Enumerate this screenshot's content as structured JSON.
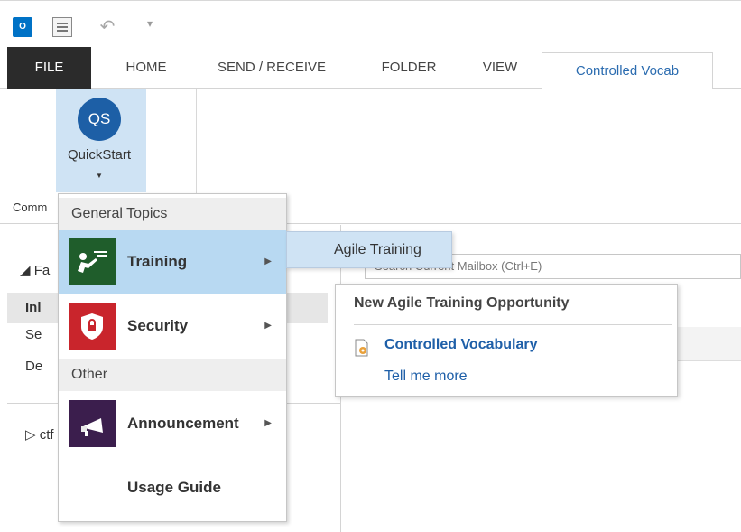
{
  "qat": {
    "app_icon_text": "O",
    "undo_glyph": "↶",
    "dropdown_glyph": "▾"
  },
  "tabs": {
    "file": "FILE",
    "home": "HOME",
    "send_receive": "SEND / RECEIVE",
    "folder": "FOLDER",
    "view": "VIEW",
    "controlled_vocab": "Controlled Vocab"
  },
  "ribbon": {
    "quickstart_badge": "QS",
    "quickstart_label": "QuickStart",
    "quickstart_arrow": "▼",
    "group_label": "Comm"
  },
  "nav": {
    "favorites": "◢ Fa",
    "inbox": "Inl",
    "sent": "Se",
    "deleted": "De",
    "ctf": "▷ ctf"
  },
  "search": {
    "placeholder": "Search Current Mailbox (Ctrl+E)"
  },
  "menu": {
    "general_header": "General Topics",
    "other_header": "Other",
    "items": [
      {
        "label": "Training",
        "arrow": "▶",
        "icon": "training-icon"
      },
      {
        "label": "Security",
        "arrow": "▶",
        "icon": "shield-icon"
      },
      {
        "label": "Announcement",
        "arrow": "▶",
        "icon": "megaphone-icon"
      },
      {
        "label": "Usage Guide"
      }
    ]
  },
  "submenu": {
    "label": "Agile Training"
  },
  "card": {
    "title": "New Agile Training Opportunity",
    "link1": "Controlled Vocabulary",
    "link2": "Tell me more"
  },
  "colors": {
    "accent": "#1d5fa6",
    "file_tab": "#2b2b2b",
    "selected": "#b8d9f2",
    "training_tile": "#1f5d2b",
    "security_tile": "#c9252c",
    "announcement_tile": "#3b1e4d",
    "link": "#1e5fa8"
  }
}
